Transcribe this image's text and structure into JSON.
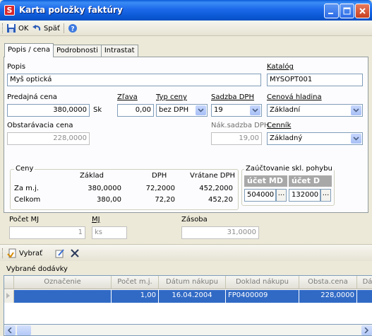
{
  "window": {
    "title": "Karta položky faktúry",
    "app_icon": "S"
  },
  "toolbar": {
    "ok_label": "OK",
    "back_label": "Späť"
  },
  "tabs": [
    {
      "label": "Popis / cena"
    },
    {
      "label": "Podrobnosti"
    },
    {
      "label": "Intrastat"
    }
  ],
  "form": {
    "popis_label": "Popis",
    "popis_value": "Myš optická",
    "katalog_label": "Katalóg",
    "katalog_value": "MYSOPT001",
    "predajna_cena_label": "Predajná cena",
    "predajna_cena_value": "380,0000",
    "currency": "Sk",
    "zlava_label": "Zľava",
    "zlava_value": "0,00",
    "typ_ceny_label": "Typ ceny",
    "typ_ceny_value": "bez DPH",
    "sadzba_dph_label": "Sadzba DPH",
    "sadzba_dph_value": "19",
    "cenova_hladina_label": "Cenová hladina",
    "cenova_hladina_value": "Základní",
    "obstaravacia_cena_label": "Obstarávacia cena",
    "obstaravacia_cena_value": "228,0000",
    "nak_sadzba_label": "Nák.sadzba DPH",
    "nak_sadzba_value": "19,00",
    "cennik_label": "Cenník",
    "cennik_value": "Základný"
  },
  "prices": {
    "group_title": "Ceny",
    "headers": [
      "Základ",
      "DPH",
      "Vrátane DPH"
    ],
    "rows": [
      {
        "label": "Za m.j.",
        "zaklad": "380,0000",
        "dph": "72,2000",
        "vratane": "452,2000"
      },
      {
        "label": "Celkom",
        "zaklad": "380,00",
        "dph": "72,20",
        "vratane": "452,20"
      }
    ]
  },
  "accounting": {
    "group_title": "Zaúčtovanie skl. pohybu",
    "md_header": "účet MD",
    "d_header": "účet D",
    "md_value": "504000",
    "d_value": "132000",
    "ellipsis": "..."
  },
  "quantity": {
    "pocet_label": "Počet MJ",
    "pocet_value": "1",
    "mj_label": "MJ",
    "mj_value": "ks",
    "zasoba_label": "Zásoba",
    "zasoba_value": "31,0000"
  },
  "subtoolbar": {
    "select_label": "Vybrať"
  },
  "deliveries": {
    "section_label": "Vybrané dodávky",
    "columns": [
      "Označenie",
      "Počet m.j.",
      "Dátum nákupu",
      "Doklad nákupu",
      "Obsta.cena",
      "Dá"
    ],
    "rows": [
      {
        "oznacenie": "",
        "pocet": "1,00",
        "datum": "16.04.2004",
        "doklad": "FP0400009",
        "cena": "228,0000",
        "da": ""
      }
    ]
  },
  "colors": {
    "title_bar": "#0b58d4",
    "selection": "#316ac5",
    "accounting_header": "#a8a8a8"
  }
}
